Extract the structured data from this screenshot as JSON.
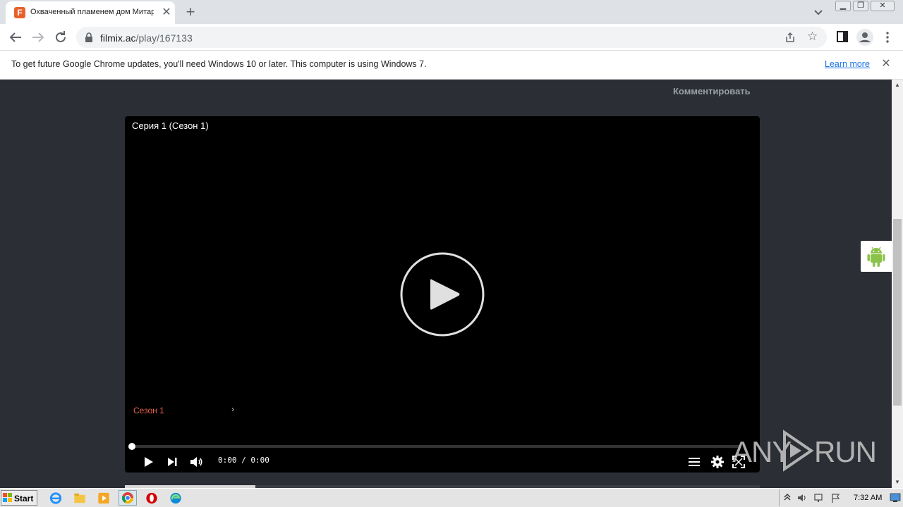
{
  "browser": {
    "tab_title": "Охваченный пламенем дом Митара",
    "tab_favicon_letter": "F",
    "url_host": "filmix.ac",
    "url_path": "/play/167133"
  },
  "infobar": {
    "message": "To get future Google Chrome updates, you'll need Windows 10 or later. This computer is using Windows 7.",
    "link_label": "Learn more"
  },
  "page": {
    "comment_link": "Комментировать"
  },
  "player": {
    "episode_title": "Серия 1 (Сезон 1)",
    "season_label": "Сезон 1",
    "time_current": "0:00",
    "time_separator": "/",
    "time_total": "0:00",
    "progress_fraction": 0,
    "accent_color": "#e8614a"
  },
  "watermark": {
    "left": "ANY",
    "right": "RUN"
  },
  "taskbar": {
    "start_label": "Start",
    "clock": "7:32 AM"
  }
}
